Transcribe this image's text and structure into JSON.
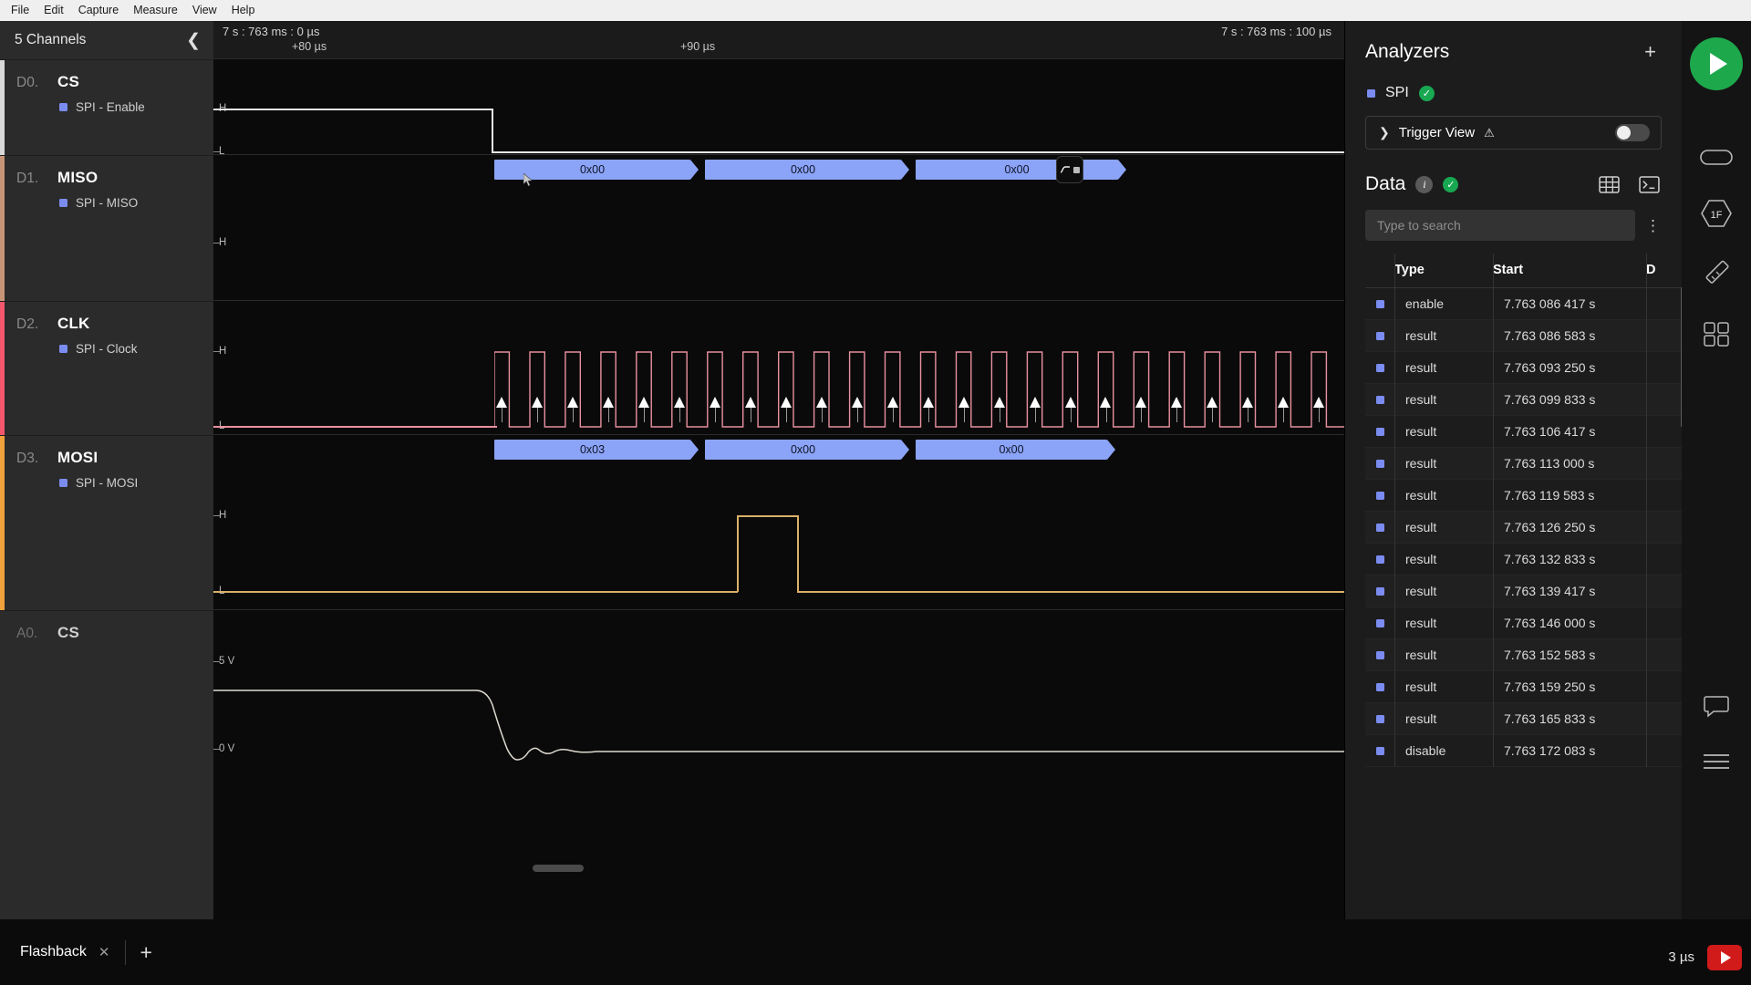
{
  "menubar": {
    "items": [
      "File",
      "Edit",
      "Capture",
      "Measure",
      "View",
      "Help"
    ]
  },
  "channels_panel": {
    "header": "5 Channels",
    "collapse_icon": "chevron-left-icon",
    "channels": [
      {
        "id": "D0.",
        "name": "CS",
        "analyzer_label": "SPI - Enable",
        "accent": "#d8d8d8"
      },
      {
        "id": "D1.",
        "name": "MISO",
        "analyzer_label": "SPI - MISO",
        "accent": "#c89477"
      },
      {
        "id": "D2.",
        "name": "CLK",
        "analyzer_label": "SPI - Clock",
        "accent": "#f4566e"
      },
      {
        "id": "D3.",
        "name": "MOSI",
        "analyzer_label": "SPI - MOSI",
        "accent": "#f0a23c"
      },
      {
        "id": "A0.",
        "name": "CS",
        "analyzer_label": "",
        "accent": "#2b2b2b"
      }
    ]
  },
  "timeline": {
    "left_timestamp": "7 s : 763 ms : 0 µs",
    "right_timestamp": "7 s : 763 ms : 100 µs",
    "tick_labels": [
      "+80 µs",
      "+90 µs"
    ]
  },
  "waveform": {
    "level_high": "H",
    "level_low": "L",
    "analog_high": "5 V",
    "analog_low": "0 V",
    "miso_packets": [
      "0x00",
      "0x00",
      "0x00"
    ],
    "mosi_packets": [
      "0x03",
      "0x00",
      "0x00"
    ],
    "badge_icon": "waveform-measure-icon",
    "clock_edge_count": 24
  },
  "analyzers": {
    "title": "Analyzers",
    "add_icon": "plus-icon",
    "items": [
      {
        "name": "SPI",
        "status": "ok",
        "status_icon": "check-circle-icon"
      }
    ],
    "trigger_view": {
      "label": "Trigger View",
      "expand_icon": "chevron-right-icon",
      "warning_icon": "warning-triangle-icon",
      "toggle_on": false
    }
  },
  "data_panel": {
    "title": "Data",
    "info_icon": "info-icon",
    "status_icon": "check-circle-icon",
    "grid_icon": "table-grid-icon",
    "terminal_icon": "terminal-icon",
    "search": {
      "placeholder": "Type to search",
      "value": ""
    },
    "menu_icon": "kebab-menu-icon",
    "columns": [
      "Type",
      "Start",
      "D"
    ],
    "rows": [
      {
        "type": "enable",
        "start": "7.763 086 417 s"
      },
      {
        "type": "result",
        "start": "7.763 086 583 s"
      },
      {
        "type": "result",
        "start": "7.763 093 250 s"
      },
      {
        "type": "result",
        "start": "7.763 099 833 s"
      },
      {
        "type": "result",
        "start": "7.763 106 417 s"
      },
      {
        "type": "result",
        "start": "7.763 113 000 s"
      },
      {
        "type": "result",
        "start": "7.763 119 583 s"
      },
      {
        "type": "result",
        "start": "7.763 126 250 s"
      },
      {
        "type": "result",
        "start": "7.763 132 833 s"
      },
      {
        "type": "result",
        "start": "7.763 139 417 s"
      },
      {
        "type": "result",
        "start": "7.763 146 000 s"
      },
      {
        "type": "result",
        "start": "7.763 152 583 s"
      },
      {
        "type": "result",
        "start": "7.763 159 250 s"
      },
      {
        "type": "result",
        "start": "7.763 165 833 s"
      },
      {
        "type": "disable",
        "start": "7.763 172 083 s"
      }
    ]
  },
  "toolbar": {
    "start_icon": "play-icon",
    "icons": [
      "device-icon",
      "hex-1f-icon",
      "ruler-icon",
      "blocks-icon",
      "comment-icon",
      "list-icon"
    ],
    "hex_label": "1F"
  },
  "tabbar": {
    "tab_name": "Flashback",
    "close_icon": "close-icon",
    "add_icon": "plus-icon",
    "duration": "3 µs",
    "record_icon": "record-play-icon",
    "accent_color": "#6a4fd8"
  },
  "colors": {
    "packet": "#8ba4f7",
    "clock": "#e8909f",
    "mosi": "#d9b06a",
    "enable": "#e6e6e6",
    "ok_green": "#18a852",
    "record_red": "#d11a1a"
  }
}
